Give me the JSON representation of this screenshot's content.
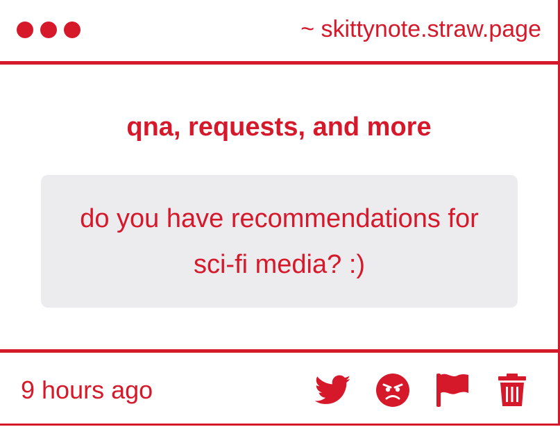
{
  "header": {
    "site_url": "~ skittynote.straw.page",
    "window_dots": 3
  },
  "main": {
    "title": "qna, requests, and more",
    "question": "do you have recommendations for sci-fi media? :)"
  },
  "footer": {
    "timestamp": "9 hours ago",
    "actions": [
      {
        "icon": "twitter-icon",
        "name": "share-twitter"
      },
      {
        "icon": "angry-face-icon",
        "name": "react-angry"
      },
      {
        "icon": "flag-icon",
        "name": "report"
      },
      {
        "icon": "trash-icon",
        "name": "delete"
      }
    ]
  },
  "colors": {
    "accent": "#d6182b",
    "question_bg": "#ecebed",
    "background": "#ffffff"
  }
}
